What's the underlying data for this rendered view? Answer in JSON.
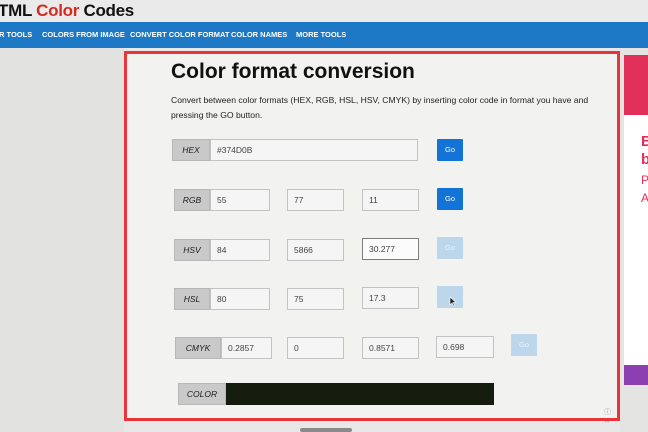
{
  "logo": {
    "prefix": "TML ",
    "color_word": "Color",
    "suffix": " Codes"
  },
  "nav": {
    "items": [
      "R TOOLS",
      "COLORS FROM IMAGE",
      "CONVERT COLOR FORMAT",
      "COLOR NAMES",
      "MORE TOOLS"
    ]
  },
  "page": {
    "title": "Color format conversion",
    "description": "Convert between color formats (HEX, RGB, HSL, HSV, CMYK) by inserting color code in format you have and pressing the GO button."
  },
  "go_label": "Go",
  "hex": {
    "label": "HEX",
    "value": "#374D0B"
  },
  "rgb": {
    "label": "RGB",
    "r": "55",
    "g": "77",
    "b": "11"
  },
  "hsv": {
    "label": "HSV",
    "h": "84",
    "s": "5866",
    "v": "30.277"
  },
  "hsl": {
    "label": "HSL",
    "h": "80",
    "s": "75",
    "l": "17.3"
  },
  "cmyk": {
    "label": "CMYK",
    "c": "0.2857",
    "m": "0",
    "y": "0.8571",
    "k": "0.698"
  },
  "color": {
    "label": "COLOR",
    "swatch": "#141c0e"
  },
  "ad": {
    "letters": [
      "B",
      "b",
      "P",
      "A"
    ],
    "close": "ⓘ ✕"
  },
  "colors": {
    "nav": "#1d78c6",
    "go": "#1473d6",
    "frame": "#e8343b",
    "logo_accent": "#d52b1e"
  }
}
